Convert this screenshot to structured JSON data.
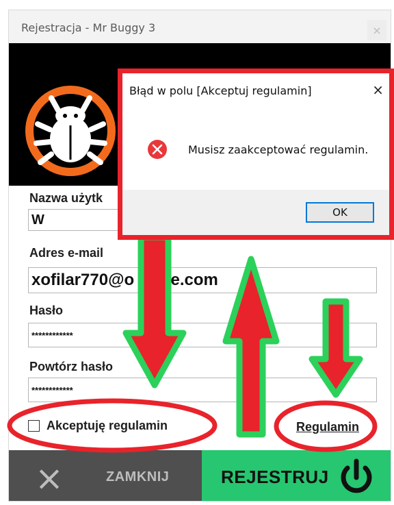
{
  "window": {
    "title": "Rejestracja - Mr Buggy 3",
    "close_glyph": "×"
  },
  "form": {
    "username_label": "Nazwa użytk",
    "username_value": "W",
    "email_label": "Adres e-mail",
    "email_value": "xofilar770@o",
    "email_value_tail": "re.com",
    "password_label": "Hasło",
    "password_value": "************",
    "repeat_label": "Powtórz hasło",
    "repeat_value": "************",
    "accept_label": "Akceptuję regulamin",
    "rules_link": "Regulamin"
  },
  "buttons": {
    "close_label": "ZAMKNIJ",
    "close_icon": "×",
    "register_label": "REJESTRUJ",
    "register_icon": "power-icon"
  },
  "dialog": {
    "title": "Błąd w polu [Akceptuj regulamin]",
    "message": "Musisz zaakceptować regulamin.",
    "ok_label": "OK",
    "close_glyph": "×",
    "icon": "error-icon"
  },
  "colors": {
    "annotation_red": "#e8232b",
    "annotation_green": "#2bd15a",
    "register_green": "#27c670",
    "close_gray": "#4f4f4f",
    "logo_orange": "#f26b1d"
  }
}
